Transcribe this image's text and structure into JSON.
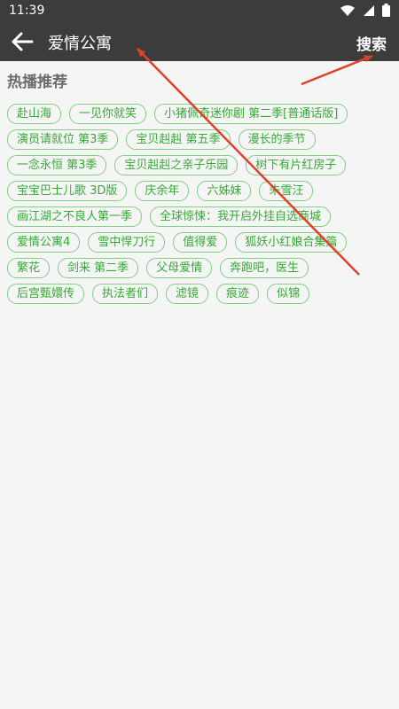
{
  "status": {
    "time": "11:39"
  },
  "search": {
    "query": "爱情公寓",
    "button_label": "搜索"
  },
  "section": {
    "title": "热播推荐"
  },
  "tags": [
    "赴山海",
    "一见你就笑",
    "小猪佩奇迷你剧 第二季[普通话版]",
    "演员请就位 第3季",
    "宝贝赳赳 第五季",
    "漫长的季节",
    "一念永恒 第3季",
    "宝贝赳赳之亲子乐园",
    "树下有片红房子",
    "宝宝巴士儿歌 3D版",
    "庆余年",
    "六姊妹",
    "朱雪汪",
    "画江湖之不良人第一季",
    "全球惊悚：我开启外挂自选商城",
    "爱情公寓4",
    "雪中悍刀行",
    "值得爱",
    "狐妖小红娘合集篇",
    "繁花",
    "剑来 第二季",
    "父母爱情",
    "奔跑吧，医生",
    "后宫甄嬛传",
    "执法者们",
    "滤镜",
    "痕迹",
    "似锦"
  ],
  "colors": {
    "toolbar": "#3c3c3c",
    "tag_text": "#33aa33",
    "tag_border": "#7fd07f",
    "arrow": "#e0402a"
  },
  "icons": {
    "back": "back-arrow-icon",
    "wifi": "wifi-icon",
    "signal": "signal-icon",
    "battery": "battery-icon"
  }
}
